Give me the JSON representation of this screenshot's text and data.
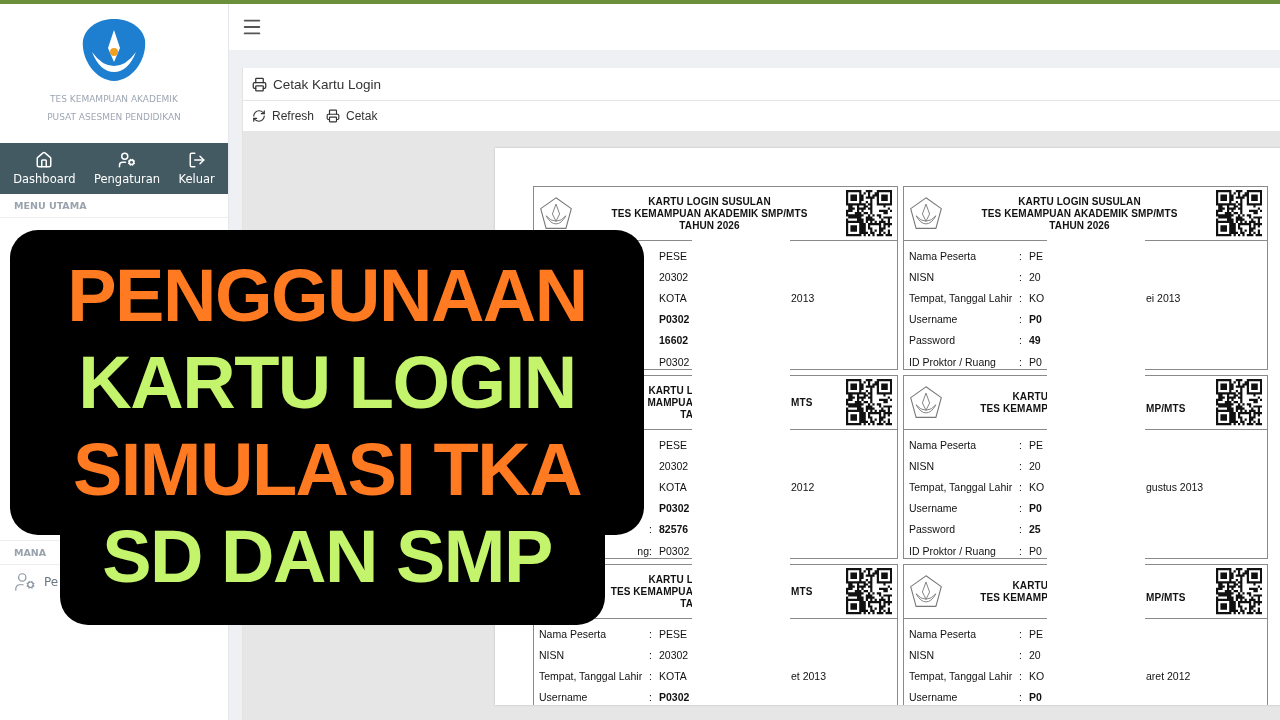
{
  "sidebar": {
    "org_lines": [
      "TES KEMAMPUAN AKADEMIK",
      "PUSAT ASESMEN PENDIDIKAN"
    ],
    "nav": [
      {
        "label": "Dashboard",
        "kind": "home"
      },
      {
        "label": "Pengaturan",
        "kind": "settings"
      },
      {
        "label": "Keluar",
        "kind": "logout"
      }
    ],
    "section_title": "MENU UTAMA",
    "section2_title": "MANA",
    "items": [
      {
        "label": "Pe"
      }
    ]
  },
  "panel": {
    "title": "Cetak Kartu Login",
    "toolbar": [
      {
        "label": "Refresh",
        "kind": "refresh"
      },
      {
        "label": "Cetak",
        "kind": "print"
      }
    ]
  },
  "cards": [
    {
      "logo": true,
      "header": [
        {
          "text": "KARTU LOGIN  SUSULAN"
        },
        {
          "text": "TES KEMAMPUAN AKADEMIK  SMP/MTS"
        },
        {
          "text": "TAHUN  2026"
        }
      ],
      "rows": [
        {
          "value": "PESE"
        },
        {
          "value": "20302"
        },
        {
          "value": "KOTA",
          "tail": "2013"
        },
        {
          "value": "P0302",
          "emphasis": true
        },
        {
          "value": "16602",
          "emphasis": true
        },
        {
          "value": "P0302"
        }
      ]
    },
    {
      "logo": true,
      "header": [
        {
          "text": "KARTU LOGIN  SUSULAN"
        },
        {
          "text": "TES KEMAMPUAN AKADEMIK  SMP/MTS"
        },
        {
          "text": "TAHUN  2026"
        }
      ],
      "rows": [
        {
          "label": "Nama Peserta",
          "sep": ":",
          "value": "PE"
        },
        {
          "label": "NISN",
          "sep": ":",
          "value": "20"
        },
        {
          "label": "Tempat, Tanggal Lahir",
          "sep": ":",
          "value": "KO",
          "tail": "ei 2013"
        },
        {
          "label": "Username",
          "sep": ":",
          "value": "P0",
          "emphasis": true
        },
        {
          "label": "Password",
          "sep": ":",
          "value": "49",
          "emphasis": true
        },
        {
          "label": "ID Proktor / Ruang",
          "sep": ":",
          "value": "P0"
        }
      ]
    },
    {
      "logo": false,
      "header": [
        {
          "left": "KARTU L"
        },
        {
          "left": "MAMPUA",
          "right": "MTS"
        },
        {
          "left": "TA"
        }
      ],
      "rows": [
        {
          "value": "PESE"
        },
        {
          "value": "20302"
        },
        {
          "value": "KOTA",
          "tail": "2012"
        },
        {
          "value": "P0302",
          "emphasis": true
        },
        {
          "sep": ":",
          "value": "82576",
          "emphasis": true
        },
        {
          "label": "ng",
          "sep": ":",
          "value": "P0302"
        }
      ]
    },
    {
      "logo": true,
      "header": [
        {
          "left": "KARTU"
        },
        {
          "left": "TES KEMAMP",
          "right": "MP/MTS"
        }
      ],
      "rows": [
        {
          "label": "Nama Peserta",
          "sep": ":",
          "value": "PE"
        },
        {
          "label": "NISN",
          "sep": ":",
          "value": "20"
        },
        {
          "label": "Tempat, Tanggal Lahir",
          "sep": ":",
          "value": "KO",
          "tail": "gustus 2013"
        },
        {
          "label": "Username",
          "sep": ":",
          "value": "P0",
          "emphasis": true
        },
        {
          "label": "Password",
          "sep": ":",
          "value": "25",
          "emphasis": true
        },
        {
          "label": "ID Proktor / Ruang",
          "sep": ":",
          "value": "P0"
        }
      ]
    },
    {
      "logo": false,
      "header": [
        {
          "left": "KARTU L"
        },
        {
          "left": "TES KEMAMPUA",
          "right": "MTS"
        },
        {
          "left": "TA"
        }
      ],
      "rows": [
        {
          "label": "Nama Peserta",
          "sep": ":",
          "value": "PESE"
        },
        {
          "label": "NISN",
          "sep": ":",
          "value": "20302"
        },
        {
          "label": "Tempat, Tanggal Lahir",
          "sep": ":",
          "value": "KOTA",
          "tail": "et 2013"
        },
        {
          "label": "Username",
          "sep": ":",
          "value": "P0302",
          "emphasis": true
        }
      ]
    },
    {
      "logo": true,
      "header": [
        {
          "left": "KARTU"
        },
        {
          "left": "TES KEMAMP",
          "right": "MP/MTS"
        }
      ],
      "rows": [
        {
          "label": "Nama Peserta",
          "sep": ":",
          "value": "PE"
        },
        {
          "label": "NISN",
          "sep": ":",
          "value": "20"
        },
        {
          "label": "Tempat, Tanggal Lahir",
          "sep": ":",
          "value": "KO",
          "tail": "aret 2012"
        },
        {
          "label": "Username",
          "sep": ":",
          "value": "P0",
          "emphasis": true
        }
      ]
    }
  ],
  "banner": {
    "lines": [
      {
        "text": "PENGGUNAAN",
        "color": "#ff7a21"
      },
      {
        "text": "KARTU LOGIN",
        "color": "#c3f46b"
      },
      {
        "text": "SIMULASI TKA",
        "color": "#ff7a21"
      },
      {
        "text": "SD DAN SMP",
        "color": "#c3f46b"
      }
    ]
  }
}
